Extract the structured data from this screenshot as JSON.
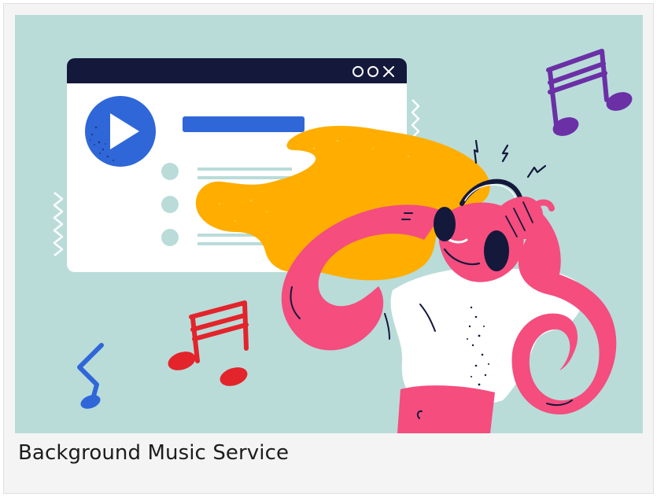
{
  "card": {
    "title": "Background Music Service",
    "illustration": {
      "subject": "person-wearing-headphones-listening-to-music",
      "window_controls": [
        "minimize-icon",
        "maximize-icon",
        "close-icon"
      ],
      "icons": [
        "play-icon",
        "music-note-icon"
      ],
      "colors": {
        "background": "#b9dcd9",
        "window_bar": "#14183b",
        "window_body": "#ffffff",
        "play_button": "#2f67d8",
        "progress_bar": "#2f67d8",
        "list_bullets": "#b9dcd9",
        "hair": "#ffae00",
        "skin": "#f44d7e",
        "shirt": "#ffffff",
        "note_purple": "#6b2fa6",
        "note_red": "#e3242b",
        "note_blue": "#2f67d8"
      }
    }
  }
}
